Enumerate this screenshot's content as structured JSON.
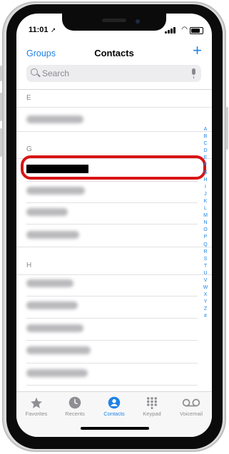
{
  "status": {
    "time": "11:01"
  },
  "nav": {
    "left": "Groups",
    "title": "Contacts",
    "add": "+"
  },
  "search": {
    "placeholder": "Search"
  },
  "sections": {
    "e": "E",
    "g": "G",
    "h": "H"
  },
  "index": [
    "A",
    "B",
    "C",
    "D",
    "E",
    "F",
    "G",
    "H",
    "I",
    "J",
    "K",
    "L",
    "M",
    "N",
    "O",
    "P",
    "Q",
    "R",
    "S",
    "T",
    "U",
    "V",
    "W",
    "X",
    "Y",
    "Z",
    "#"
  ],
  "tabs": [
    {
      "label": "Favorites",
      "icon": "star-icon"
    },
    {
      "label": "Recents",
      "icon": "clock-icon"
    },
    {
      "label": "Contacts",
      "icon": "person-icon",
      "active": true
    },
    {
      "label": "Keypad",
      "icon": "keypad-icon"
    },
    {
      "label": "Voicemail",
      "icon": "voicemail-icon"
    }
  ],
  "colors": {
    "accent": "#1e82e6",
    "highlight": "#d81414"
  }
}
